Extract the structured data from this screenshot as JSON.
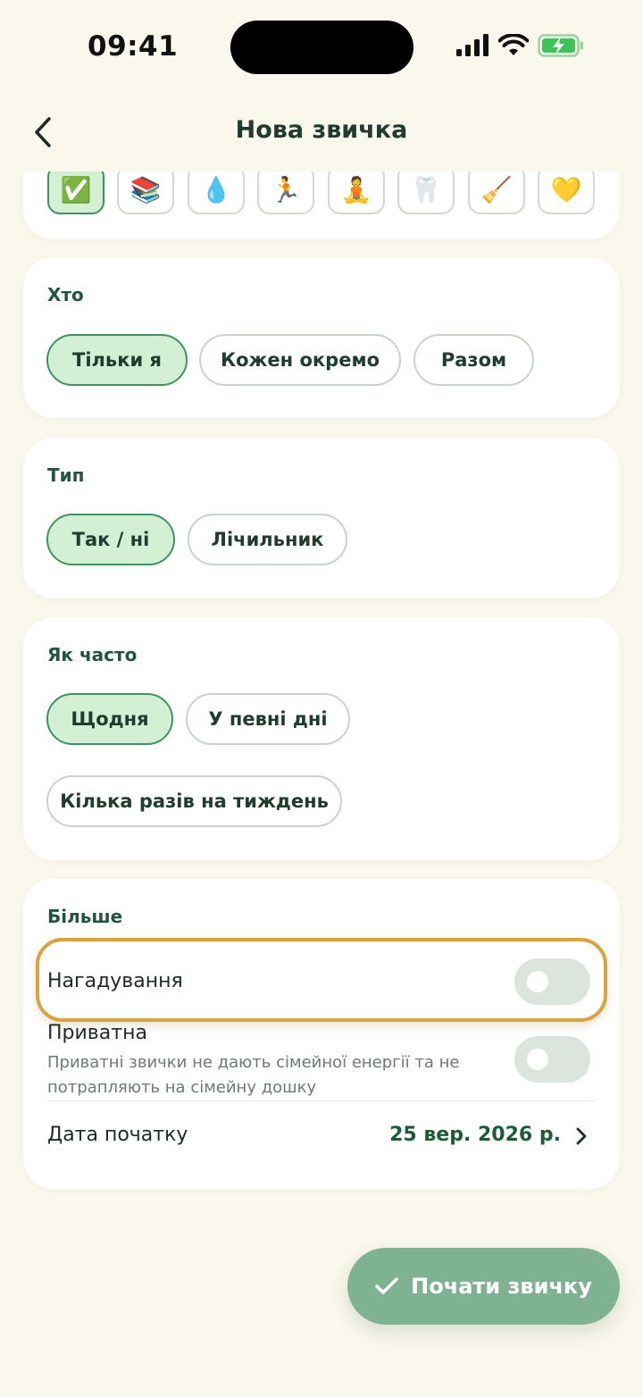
{
  "status_bar": {
    "time": "09:41"
  },
  "nav": {
    "title": "Нова звичка",
    "back_icon": "chevron-left-icon"
  },
  "emoji_picker": {
    "items": [
      {
        "emoji": "✅",
        "selected": true
      },
      {
        "emoji": "📚",
        "selected": false
      },
      {
        "emoji": "💧",
        "selected": false
      },
      {
        "emoji": "🏃",
        "selected": false
      },
      {
        "emoji": "🧘",
        "selected": false
      },
      {
        "emoji": "🦷",
        "selected": false
      },
      {
        "emoji": "🧹",
        "selected": false
      },
      {
        "emoji": "💛",
        "selected": false
      }
    ]
  },
  "who": {
    "title": "Хто",
    "options": [
      {
        "label": "Тільки я",
        "selected": true
      },
      {
        "label": "Кожен окремо",
        "selected": false
      },
      {
        "label": "Разом",
        "selected": false
      }
    ]
  },
  "type": {
    "title": "Тип",
    "options": [
      {
        "label": "Так / ні",
        "selected": true
      },
      {
        "label": "Лічильник",
        "selected": false
      }
    ]
  },
  "frequency": {
    "title": "Як часто",
    "options": [
      {
        "label": "Щодня",
        "selected": true
      },
      {
        "label": "У певні дні",
        "selected": false
      },
      {
        "label": "Кілька разів на тиждень",
        "selected": false
      }
    ]
  },
  "more": {
    "title": "Більше",
    "reminders": {
      "label": "Нагадування",
      "enabled": false
    },
    "private": {
      "label": "Приватна",
      "description": "Приватні звички не дають сімейної енергії та не потрапляють на сімейну дошку",
      "enabled": false
    },
    "start_date": {
      "label": "Дата початку",
      "value": "25 вер. 2026 р."
    }
  },
  "fab": {
    "label": "Почати звичку",
    "icon": "checkmark-icon"
  },
  "colors": {
    "background": "#FAF7EC",
    "accent_green": "#22553F",
    "selected_chip_bg": "#D4F0D4",
    "selected_chip_border": "#3C9560",
    "fab": "#7FB293",
    "highlight": "#D7A43F"
  }
}
